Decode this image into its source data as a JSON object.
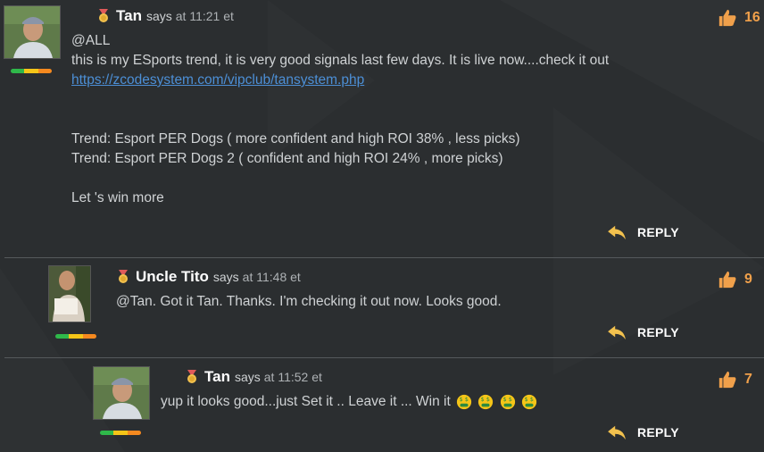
{
  "comments": [
    {
      "author": "Tan",
      "says": "says",
      "time": "at 11:21 et",
      "likes": "16",
      "lines": [
        "@ALL",
        "this is my ESports trend, it is very good signals last few days. It is live now....check it out"
      ],
      "link": "https://zcodesystem.com/vipclub/tansystem.php",
      "lines2": [
        "Trend: Esport PER Dogs ( more confident and high ROI 38% , less picks)",
        "Trend: Esport PER Dogs 2 ( confident and high ROI 24% , more picks)"
      ],
      "closing": "Let 's win more",
      "reply": "REPLY"
    },
    {
      "author": "Uncle Tito",
      "says": "says",
      "time": "at 11:48 et",
      "likes": "9",
      "text": "@Tan. Got it Tan. Thanks. I'm checking it out now. Looks good.",
      "reply": "REPLY"
    },
    {
      "author": "Tan",
      "says": "says",
      "time": "at 11:52 et",
      "likes": "7",
      "text": "yup it looks good...just Set it .. Leave it ... Win it",
      "reply": "REPLY"
    }
  ],
  "icons": {
    "medal": "medal-icon",
    "like": "thumbs-up-icon",
    "reply": "reply-arrow-icon",
    "emoji": "money-mouth-face-icon"
  },
  "colors": {
    "background": "#2b2e30",
    "link": "#4c8fd6",
    "like_count": "#f0a04b",
    "meter": [
      "#2fb84a",
      "#f5c518",
      "#f5891f"
    ]
  }
}
